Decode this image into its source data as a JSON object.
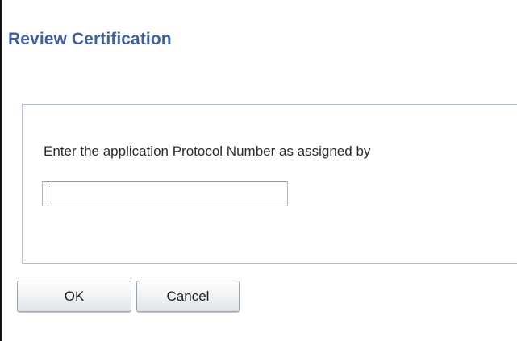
{
  "dialog": {
    "title": "Review Certification",
    "prompt": "Enter the application Protocol Number as assigned by",
    "protocol_input": {
      "value": "",
      "placeholder": ""
    },
    "buttons": {
      "ok_label": "OK",
      "cancel_label": "Cancel"
    }
  }
}
